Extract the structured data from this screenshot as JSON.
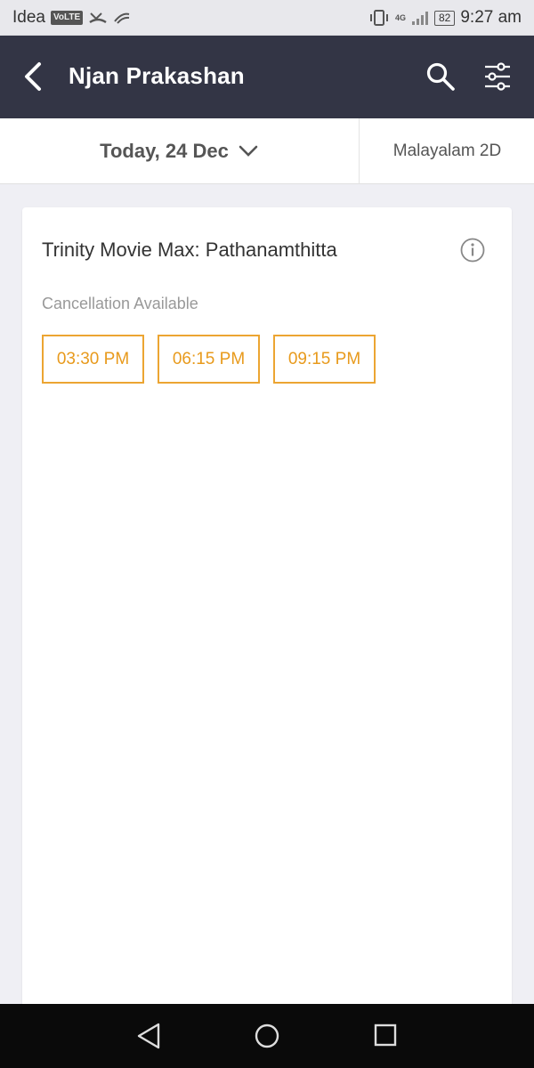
{
  "status_bar": {
    "carrier": "Idea",
    "volte": "VoLTE",
    "network": "4G",
    "battery": "82",
    "time": "9:27 am"
  },
  "app_bar": {
    "title": "Njan Prakashan",
    "icons": [
      "back-arrow-icon",
      "search-icon",
      "filter-sliders-icon"
    ],
    "background": "#333545"
  },
  "filters": {
    "date": "Today, 24 Dec",
    "language_format": "Malayalam 2D"
  },
  "venue": {
    "name": "Trinity Movie Max: Pathanamthitta",
    "note": "Cancellation Available",
    "showtimes": [
      "03:30 PM",
      "06:15 PM",
      "09:15 PM"
    ],
    "accent": "#eca532"
  },
  "nav_bar": {
    "icons": [
      "nav-back-icon",
      "nav-home-icon",
      "nav-recent-icon"
    ]
  }
}
